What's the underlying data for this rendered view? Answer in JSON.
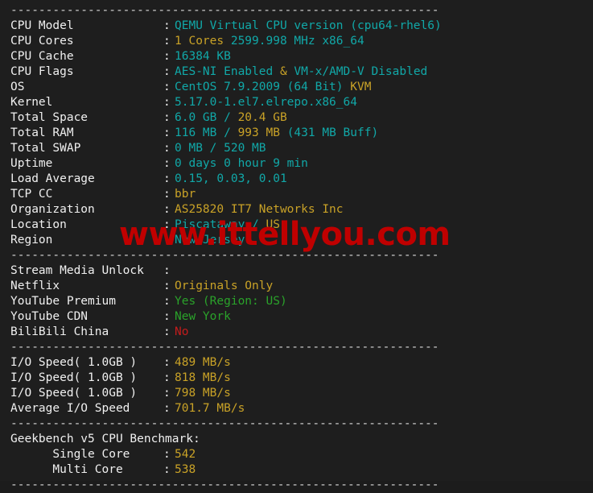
{
  "terminal": {
    "background_color": "#1e1e1e",
    "separator": "-------------------------------------------------------------",
    "watermark": "www.ittellyou.com",
    "colon": ":",
    "colors": {
      "label": "#f0f0f0",
      "teal": "#11a8a8",
      "yellow": "#c9a227",
      "green": "#2aa22a",
      "red": "#c41c1c",
      "watermark": "#c00000"
    }
  },
  "system_info": [
    {
      "label": "CPU Model",
      "parts": [
        {
          "text": "QEMU Virtual CPU version (cpu64-rhel6)",
          "color": "teal"
        }
      ]
    },
    {
      "label": "CPU Cores",
      "parts": [
        {
          "text": "1 Cores ",
          "color": "yellow"
        },
        {
          "text": "2599.998 MHz x86_64",
          "color": "teal"
        }
      ]
    },
    {
      "label": "CPU Cache",
      "parts": [
        {
          "text": "16384 KB",
          "color": "teal"
        }
      ]
    },
    {
      "label": "CPU Flags",
      "parts": [
        {
          "text": "AES-NI Enabled",
          "color": "teal"
        },
        {
          "text": " & ",
          "color": "yellow"
        },
        {
          "text": "VM-x/AMD-V Disabled",
          "color": "teal"
        }
      ]
    },
    {
      "label": "OS",
      "parts": [
        {
          "text": "CentOS 7.9.2009 (64 Bit) ",
          "color": "teal"
        },
        {
          "text": "KVM",
          "color": "yellow"
        }
      ]
    },
    {
      "label": "Kernel",
      "parts": [
        {
          "text": "5.17.0-1.el7.elrepo.x86_64",
          "color": "teal"
        }
      ]
    },
    {
      "label": "Total Space",
      "parts": [
        {
          "text": "6.0 GB ",
          "color": "teal"
        },
        {
          "text": "/ ",
          "color": "teal"
        },
        {
          "text": "20.4 GB",
          "color": "yellow"
        }
      ]
    },
    {
      "label": "Total RAM",
      "parts": [
        {
          "text": "116 MB ",
          "color": "teal"
        },
        {
          "text": "/ ",
          "color": "teal"
        },
        {
          "text": "993 MB ",
          "color": "yellow"
        },
        {
          "text": "(431 MB Buff)",
          "color": "teal"
        }
      ]
    },
    {
      "label": "Total SWAP",
      "parts": [
        {
          "text": "0 MB / 520 MB",
          "color": "teal"
        }
      ]
    },
    {
      "label": "Uptime",
      "parts": [
        {
          "text": "0 days 0 hour 9 min",
          "color": "teal"
        }
      ]
    },
    {
      "label": "Load Average",
      "parts": [
        {
          "text": "0.15, 0.03, 0.01",
          "color": "teal"
        }
      ]
    },
    {
      "label": "TCP CC",
      "parts": [
        {
          "text": "bbr",
          "color": "yellow"
        }
      ]
    },
    {
      "label": "Organization",
      "parts": [
        {
          "text": "AS25820 IT7 Networks Inc",
          "color": "yellow"
        }
      ]
    },
    {
      "label": "Location",
      "parts": [
        {
          "text": "Piscataway / ",
          "color": "teal"
        },
        {
          "text": "US",
          "color": "yellow"
        }
      ]
    },
    {
      "label": "Region",
      "parts": [
        {
          "text": "New Jersey",
          "color": "teal"
        }
      ]
    }
  ],
  "stream_media": [
    {
      "label": "Stream Media Unlock",
      "parts": []
    },
    {
      "label": "Netflix",
      "parts": [
        {
          "text": "Originals Only",
          "color": "yellow"
        }
      ]
    },
    {
      "label": "YouTube Premium",
      "parts": [
        {
          "text": "Yes (Region: US)",
          "color": "green"
        }
      ]
    },
    {
      "label": "YouTube CDN",
      "parts": [
        {
          "text": "New York",
          "color": "green"
        }
      ]
    },
    {
      "label": "BiliBili China",
      "parts": [
        {
          "text": "No",
          "color": "red"
        }
      ]
    }
  ],
  "io_speed": [
    {
      "label": "I/O Speed( 1.0GB )",
      "parts": [
        {
          "text": "489 MB/s",
          "color": "yellow"
        }
      ]
    },
    {
      "label": "I/O Speed( 1.0GB )",
      "parts": [
        {
          "text": "818 MB/s",
          "color": "yellow"
        }
      ]
    },
    {
      "label": "I/O Speed( 1.0GB )",
      "parts": [
        {
          "text": "798 MB/s",
          "color": "yellow"
        }
      ]
    },
    {
      "label": "Average I/O Speed",
      "parts": [
        {
          "text": "701.7 MB/s",
          "color": "yellow"
        }
      ]
    }
  ],
  "geekbench": {
    "title": "Geekbench v5 CPU Benchmark:",
    "rows": [
      {
        "label": "      Single Core",
        "parts": [
          {
            "text": "542",
            "color": "yellow"
          }
        ]
      },
      {
        "label": "      Multi Core",
        "parts": [
          {
            "text": "538",
            "color": "yellow"
          }
        ]
      }
    ]
  }
}
